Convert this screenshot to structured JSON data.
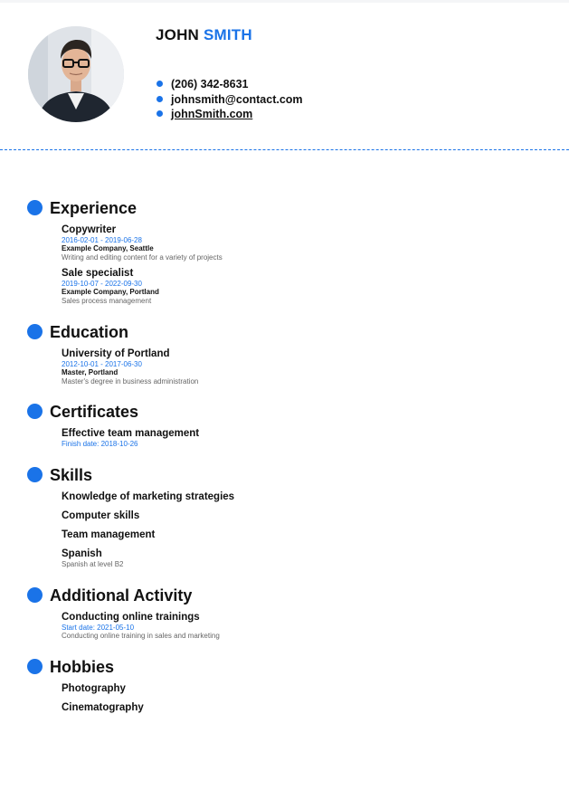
{
  "header": {
    "first_name": "JOHN",
    "last_name": "SMITH",
    "photo_description": "avatar"
  },
  "contacts": {
    "phone": "(206) 342-8631",
    "email": "johnsmith@contact.com",
    "website": "johnSmith.com"
  },
  "colors": {
    "accent": "#1a73e8"
  },
  "sections": {
    "experience": {
      "title": "Experience",
      "items": [
        {
          "title": "Copywriter",
          "date": "2016-02-01 - 2019-06-28",
          "org": "Example Company, Seattle",
          "desc": "Writing and editing content for a variety of projects"
        },
        {
          "title": "Sale specialist",
          "date": "2019-10-07 - 2022-09-30",
          "org": "Example Company, Portland",
          "desc": "Sales process management"
        }
      ]
    },
    "education": {
      "title": "Education",
      "items": [
        {
          "title": "University of Portland",
          "date": "2012-10-01 - 2017-06-30",
          "org": "Master, Portland",
          "desc": "Master's degree in business administration"
        }
      ]
    },
    "certificates": {
      "title": "Certificates",
      "items": [
        {
          "title": "Effective team management",
          "date": "Finish date: 2018-10-26"
        }
      ]
    },
    "skills": {
      "title": "Skills",
      "items": [
        {
          "title": "Knowledge of marketing strategies"
        },
        {
          "title": "Computer skills"
        },
        {
          "title": "Team management"
        },
        {
          "title": "Spanish",
          "desc": "Spanish at level B2"
        }
      ]
    },
    "additional": {
      "title": "Additional Activity",
      "items": [
        {
          "title": "Conducting online trainings",
          "date": "Start date: 2021-05-10",
          "desc": "Conducting online training in sales and marketing"
        }
      ]
    },
    "hobbies": {
      "title": "Hobbies",
      "items": [
        {
          "title": "Photography"
        },
        {
          "title": "Cinematography"
        }
      ]
    }
  }
}
